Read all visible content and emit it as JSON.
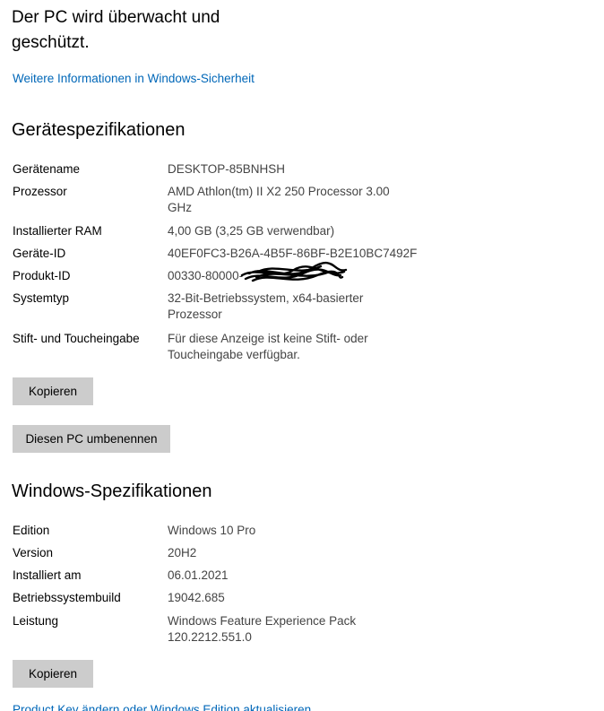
{
  "status": {
    "title": "Der PC wird überwacht und geschützt.",
    "more_info_link": "Weitere Informationen in Windows-Sicherheit"
  },
  "device_specs": {
    "heading": "Gerätespezifikationen",
    "rows": [
      {
        "label": "Gerätename",
        "value": "DESKTOP-85BNHSH"
      },
      {
        "label": "Prozessor",
        "value": "AMD Athlon(tm) II X2 250 Processor   3.00 GHz"
      },
      {
        "label": "Installierter RAM",
        "value": "4,00 GB (3,25 GB verwendbar)"
      },
      {
        "label": "Geräte-ID",
        "value": "40EF0FC3-B26A-4B5F-86BF-B2E10BC7492F"
      },
      {
        "label": "Produkt-ID",
        "value": "00330-80000-"
      },
      {
        "label": "Systemtyp",
        "value": "32-Bit-Betriebssystem, x64-basierter Prozessor"
      },
      {
        "label": "Stift- und Toucheingabe",
        "value": "Für diese Anzeige ist keine Stift- oder Toucheingabe verfügbar."
      }
    ],
    "copy_button": "Kopieren",
    "rename_button": "Diesen PC umbenennen"
  },
  "windows_specs": {
    "heading": "Windows-Spezifikationen",
    "rows": [
      {
        "label": "Edition",
        "value": "Windows 10 Pro"
      },
      {
        "label": "Version",
        "value": "20H2"
      },
      {
        "label": "Installiert am",
        "value": "06.01.2021"
      },
      {
        "label": "Betriebssystembuild",
        "value": "19042.685"
      },
      {
        "label": "Leistung",
        "value": "Windows Feature Experience Pack 120.2212.551.0"
      }
    ],
    "copy_button": "Kopieren",
    "product_key_link": "Product Key ändern oder Windows Edition aktualisieren"
  },
  "colors": {
    "link": "#0067b8",
    "button_bg": "#cccccc",
    "value_text": "#444444"
  }
}
